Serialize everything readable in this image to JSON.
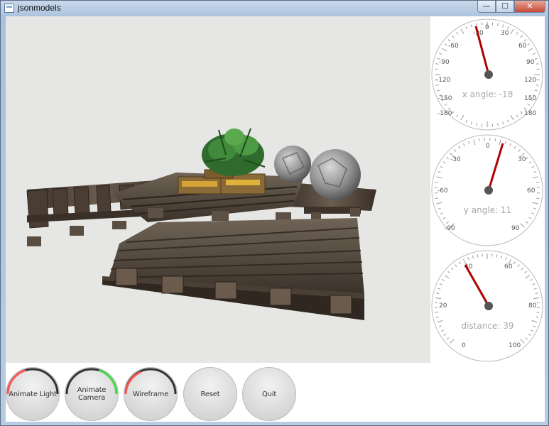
{
  "window": {
    "title": "jsonmodels",
    "buttons": {
      "minimize": "—",
      "maximize": "☐",
      "close": "✕"
    }
  },
  "scene": {
    "background_color": "#e6e7e5",
    "objects": [
      "wooden-pallets",
      "green-plant",
      "wooden-crates",
      "stone-spheres"
    ]
  },
  "gauges": [
    {
      "id": "x-angle",
      "label": "x angle: -18",
      "ticks": [
        "-30",
        "0",
        "30",
        "60",
        "90",
        "120",
        "150",
        "180",
        "-180",
        "-150",
        "-120",
        "-90",
        "-60"
      ],
      "needle_color": "#b00000"
    },
    {
      "id": "y-angle",
      "label": "y angle: 11",
      "ticks": [
        "0",
        "30",
        "60",
        "90",
        "-90",
        "-60",
        "-30"
      ],
      "needle_color": "#b00000"
    },
    {
      "id": "distance",
      "label": "distance: 39",
      "ticks": [
        "0",
        "20",
        "40",
        "60",
        "80",
        "100"
      ],
      "needle_color": "#b00000"
    }
  ],
  "buttons": [
    {
      "label": "Animate Light",
      "ring_color": "#ff5555",
      "ring_fraction": 0.25
    },
    {
      "label": "Animate Camera",
      "ring_color": "#44dd44",
      "ring_fraction": 0.25
    },
    {
      "label": "Wireframe",
      "ring_color": "#ff5555",
      "ring_fraction": 0.2
    },
    {
      "label": "Reset"
    },
    {
      "label": "Quit"
    }
  ]
}
